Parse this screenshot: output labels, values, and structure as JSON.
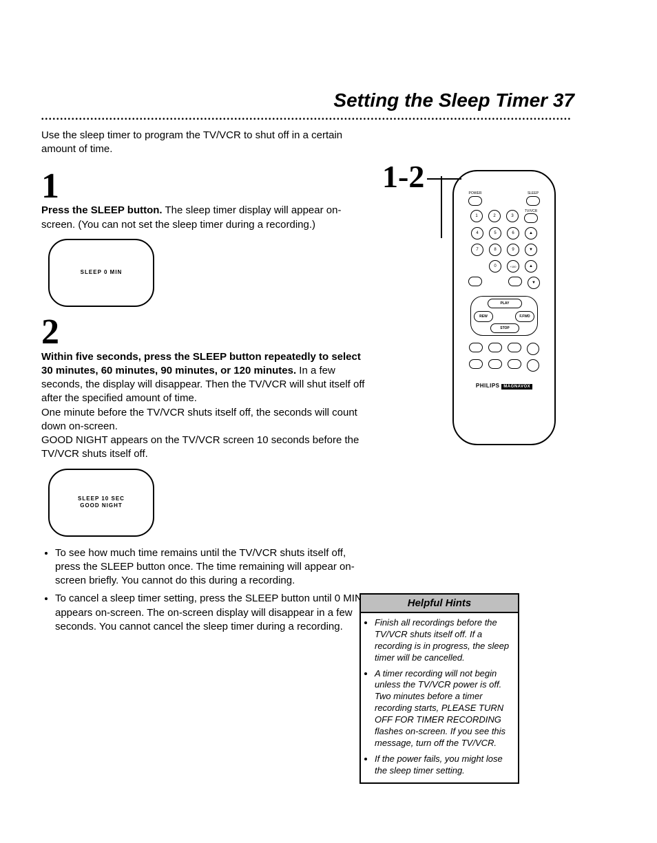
{
  "title": "Setting the Sleep Timer  37",
  "intro": "Use the sleep timer to program the TV/VCR to shut off in a certain amount of time.",
  "step1": {
    "num": "1",
    "bold": "Press the SLEEP button.",
    "rest": " The sleep timer display will appear on-screen. (You can not set the sleep timer during a recording.)",
    "screen_line1": "SLEEP   0   MIN"
  },
  "step2": {
    "num": "2",
    "bold": "Within five seconds, press the SLEEP button repeatedly to select 30 minutes, 60 minutes, 90 minutes, or 120 minutes.",
    "rest": " In a few seconds, the display will disappear. Then the TV/VCR will shut itself off after the specified amount of time.",
    "p2": "One minute before the TV/VCR shuts itself off, the seconds will count down on-screen.",
    "p3": "GOOD NIGHT appears on the TV/VCR screen 10 seconds before the TV/VCR shuts itself off.",
    "screen_line1": "SLEEP   10   SEC",
    "screen_line2": "GOOD NIGHT"
  },
  "bullets": [
    "To see how much time remains until the TV/VCR shuts itself off, press the SLEEP button once. The time remaining will appear on-screen briefly. You cannot do this during a recording.",
    "To cancel a sleep timer setting, press the SLEEP button until 0 MIN appears on-screen. The on-screen display will disappear in a few seconds. You cannot cancel the sleep timer during a recording."
  ],
  "callout": "1-2",
  "remote": {
    "labels": {
      "power": "POWER",
      "sleep": "SLEEP",
      "tvvcr": "TV/VCR",
      "chup": "▲",
      "chdn": "▼",
      "volup": "▲",
      "voldn": "▼",
      "play": "PLAY",
      "rew": "REW",
      "ffwd": "F.FWD",
      "stop": "STOP",
      "brand1": "PHILIPS",
      "brand2": "MAGNAVOX"
    },
    "numbers": [
      "1",
      "2",
      "3",
      "4",
      "5",
      "6",
      "7",
      "8",
      "9",
      "0",
      "+100"
    ]
  },
  "hints": {
    "title": "Helpful Hints",
    "items": [
      "Finish all recordings before the TV/VCR shuts itself off. If a recording is in progress, the sleep timer will be cancelled.",
      "A timer recording will not begin unless the TV/VCR power is off. Two minutes before a timer recording starts, PLEASE TURN OFF FOR TIMER RECORDING flashes on-screen. If you see this message, turn off the TV/VCR.",
      "If the power fails, you might lose the sleep timer setting."
    ]
  }
}
